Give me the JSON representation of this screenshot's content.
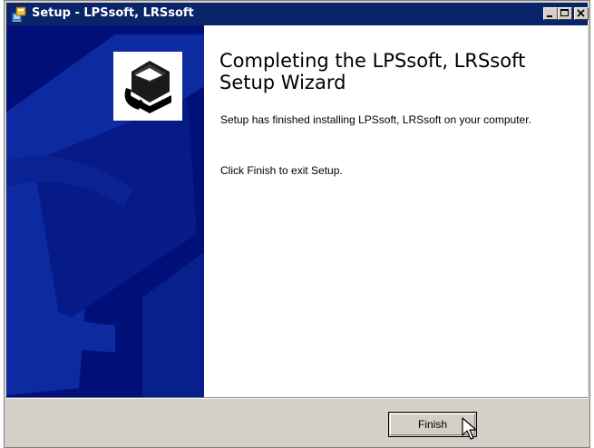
{
  "window": {
    "title": "Setup - LPSsoft, LRSsoft"
  },
  "titlebar_controls": {
    "minimize_icon": "minimize-icon",
    "maximize_icon": "maximize-icon",
    "close_icon": "close-icon"
  },
  "wizard": {
    "heading_line1": "Completing the LPSsoft, LRSsoft",
    "heading_line2": "Setup Wizard",
    "message": "Setup has finished installing LPSsoft, LRSsoft on your computer.",
    "exit_hint": "Click Finish to exit Setup."
  },
  "buttons": {
    "finish_label": "Finish"
  },
  "colors": {
    "titlebar": "#0a246a",
    "side_panel": "#001078",
    "dialog_face": "#d4d0c8"
  }
}
